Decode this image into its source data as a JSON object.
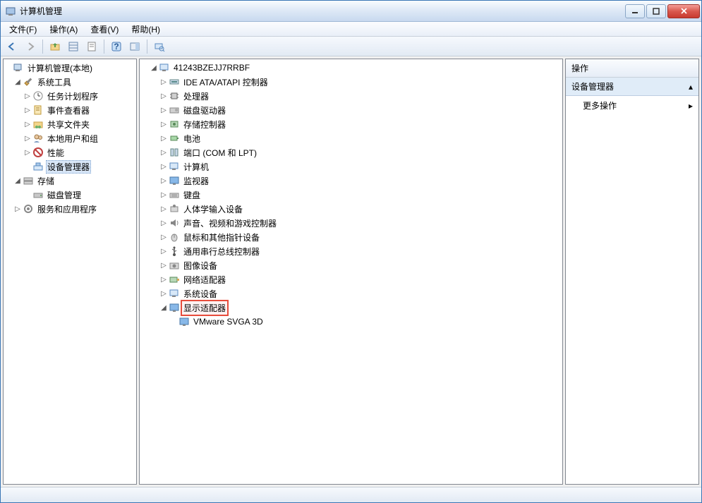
{
  "window": {
    "title": "计算机管理"
  },
  "menu": {
    "file": "文件(F)",
    "action": "操作(A)",
    "view": "查看(V)",
    "help": "帮助(H)"
  },
  "left_tree": {
    "root": "计算机管理(本地)",
    "sys_tools": "系统工具",
    "task_scheduler": "任务计划程序",
    "event_viewer": "事件查看器",
    "shared_folders": "共享文件夹",
    "local_users": "本地用户和组",
    "performance": "性能",
    "device_manager": "设备管理器",
    "storage": "存储",
    "disk_mgmt": "磁盘管理",
    "services_apps": "服务和应用程序"
  },
  "device_tree": {
    "computer": "41243BZEJJ7RRBF",
    "ide": "IDE ATA/ATAPI 控制器",
    "cpu": "处理器",
    "disk": "磁盘驱动器",
    "storage_ctrl": "存储控制器",
    "battery": "电池",
    "ports": "端口 (COM 和 LPT)",
    "computers": "计算机",
    "monitors": "监视器",
    "keyboards": "键盘",
    "hid": "人体学输入设备",
    "audio": "声音、视频和游戏控制器",
    "mouse": "鼠标和其他指针设备",
    "usb": "通用串行总线控制器",
    "imaging": "图像设备",
    "network": "网络适配器",
    "system": "系统设备",
    "display": "显示适配器",
    "display_item": "VMware SVGA 3D"
  },
  "actions": {
    "header": "操作",
    "section": "设备管理器",
    "more": "更多操作"
  }
}
